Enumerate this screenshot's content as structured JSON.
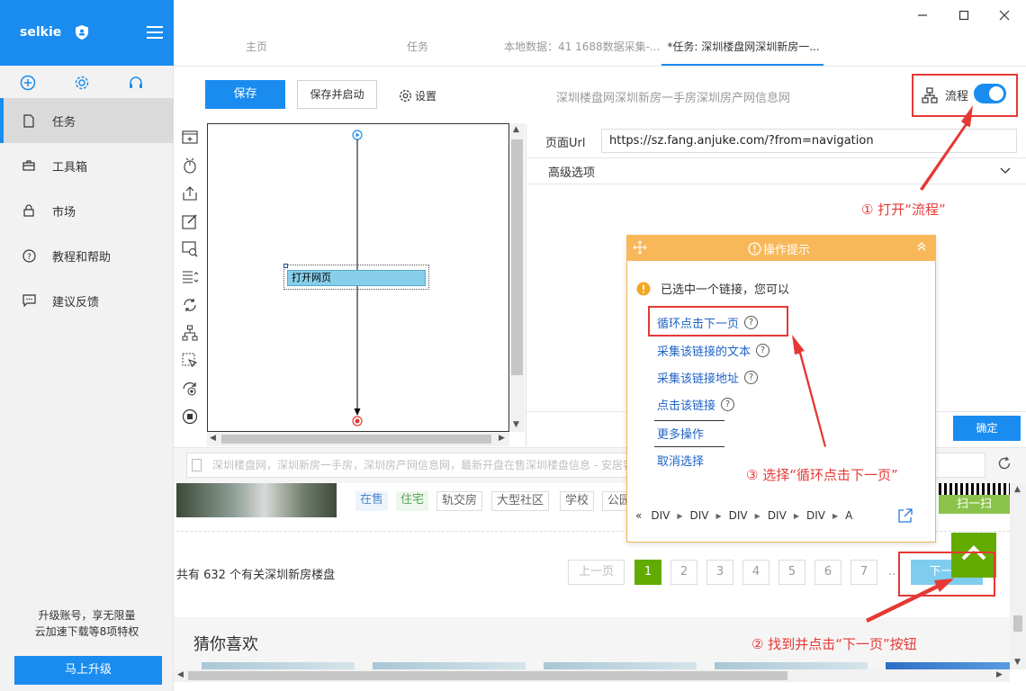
{
  "app": {
    "name": "selkie",
    "tools": [
      "add-icon",
      "gear-icon",
      "headset-icon"
    ]
  },
  "sidebar": {
    "items": [
      {
        "label": "任务",
        "icon": "document-icon",
        "active": true
      },
      {
        "label": "工具箱",
        "icon": "toolbox-icon"
      },
      {
        "label": "市场",
        "icon": "lock-icon"
      },
      {
        "label": "教程和帮助",
        "icon": "help-circle-icon"
      },
      {
        "label": "建议反馈",
        "icon": "feedback-icon"
      }
    ],
    "upgrade_line1": "升级账号，享无限量",
    "upgrade_line2": "云加速下载等8项特权",
    "upgrade_button": "马上升级"
  },
  "tabs": [
    {
      "label": "主页"
    },
    {
      "label": "任务"
    },
    {
      "label": "本地数据：41 1688数据采集-..."
    },
    {
      "label": "*任务: 深圳楼盘网深圳新房一...",
      "active": true
    }
  ],
  "toolbar": {
    "save": "保存",
    "save_start": "保存并启动",
    "settings": "设置",
    "task_title": "深圳楼盘网深圳新房一手房深圳房产网信息网",
    "flow_label": "流程",
    "flow_enabled": true
  },
  "canvas": {
    "node_label": "打开网页"
  },
  "panel": {
    "url_label": "页面Url",
    "url_value": "https://sz.fang.anjuke.com/?from=navigation",
    "advanced_label": "高级选项",
    "confirm": "确定"
  },
  "browser": {
    "address_text": "深圳楼盘网，深圳新房一手房，深圳房产网信息网，最新开盘在售深圳楼盘信息 - 安居客"
  },
  "webpage": {
    "tags": [
      "在售",
      "住宅",
      "轨交房",
      "大型社区",
      "学校",
      "公园"
    ],
    "scan_label": "扫一扫",
    "total_text": "共有 632 个有关深圳新房楼盘",
    "pagination": {
      "prev": "上一页",
      "pages": [
        "1",
        "2",
        "3",
        "4",
        "5",
        "6",
        "7"
      ],
      "ellipsis": "..",
      "next": "下一页",
      "current": 1
    },
    "guess_title": "猜你喜欢"
  },
  "tip": {
    "title": "操作提示",
    "message": "已选中一个链接，您可以",
    "options": [
      "循环点击下一页",
      "采集该链接的文本",
      "采集该链接地址",
      "点击该链接"
    ],
    "more": "更多操作",
    "cancel": "取消选择",
    "crumbs": [
      "DIV",
      "DIV",
      "DIV",
      "DIV",
      "DIV",
      "A"
    ]
  },
  "annotations": {
    "a1": "① 打开“流程”",
    "a2": "② 找到并点击“下一页”按钮",
    "a3": "③ 选择“循环点击下一页”"
  },
  "colors": {
    "primary": "#1a8cf0",
    "annotation_red": "#e53935",
    "tip_orange": "#f8b859",
    "page_green": "#62ab00"
  }
}
